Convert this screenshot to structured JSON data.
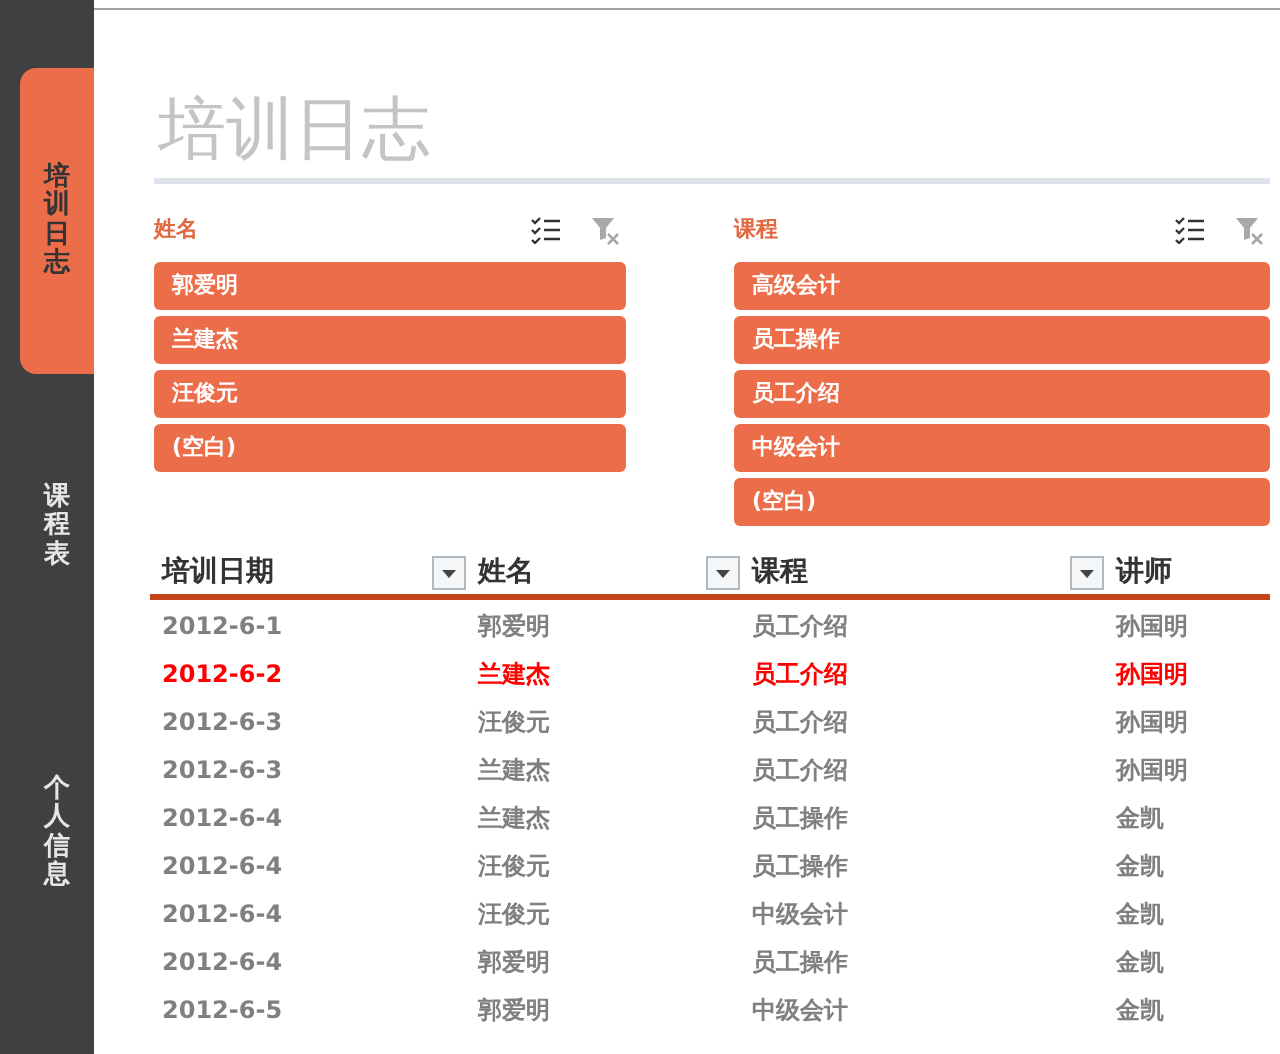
{
  "sidebar": {
    "tabs": [
      {
        "label": "培训日志",
        "selected": true
      },
      {
        "label": "课程表",
        "selected": false
      },
      {
        "label": "个人信息",
        "selected": false
      }
    ]
  },
  "title": "培训日志",
  "slicers": [
    {
      "header": "姓名",
      "items": [
        "郭爱明",
        "兰建杰",
        "汪俊元",
        "(空白)"
      ]
    },
    {
      "header": "课程",
      "items": [
        "高级会计",
        "员工操作",
        "员工介绍",
        "中级会计",
        "(空白)"
      ]
    }
  ],
  "table": {
    "columns": [
      "培训日期",
      "姓名",
      "课程",
      "讲师"
    ],
    "rows": [
      {
        "cells": [
          "2012-6-1",
          "郭爱明",
          "员工介绍",
          "孙国明"
        ],
        "highlighted": false
      },
      {
        "cells": [
          "2012-6-2",
          "兰建杰",
          "员工介绍",
          "孙国明"
        ],
        "highlighted": true
      },
      {
        "cells": [
          "2012-6-3",
          "汪俊元",
          "员工介绍",
          "孙国明"
        ],
        "highlighted": false
      },
      {
        "cells": [
          "2012-6-3",
          "兰建杰",
          "员工介绍",
          "孙国明"
        ],
        "highlighted": false
      },
      {
        "cells": [
          "2012-6-4",
          "兰建杰",
          "员工操作",
          "金凯"
        ],
        "highlighted": false
      },
      {
        "cells": [
          "2012-6-4",
          "汪俊元",
          "员工操作",
          "金凯"
        ],
        "highlighted": false
      },
      {
        "cells": [
          "2012-6-4",
          "汪俊元",
          "中级会计",
          "金凯"
        ],
        "highlighted": false
      },
      {
        "cells": [
          "2012-6-4",
          "郭爱明",
          "员工操作",
          "金凯"
        ],
        "highlighted": false
      },
      {
        "cells": [
          "2012-6-5",
          "郭爱明",
          "中级会计",
          "金凯"
        ],
        "highlighted": false
      }
    ]
  }
}
